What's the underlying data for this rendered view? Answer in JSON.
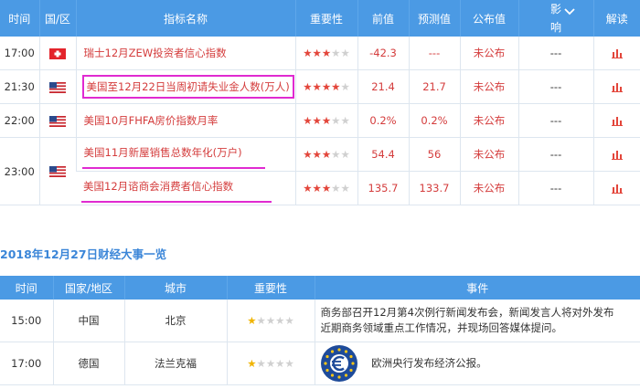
{
  "table1": {
    "headers": [
      "时间",
      "国/区",
      "指标名称",
      "重要性",
      "前值",
      "预测值",
      "公布值",
      "影　响",
      "解读"
    ],
    "rows": [
      {
        "time": "17:00",
        "flag": "switzerland",
        "name": "瑞士12月ZEW投资者信心指数",
        "stars": 3,
        "prev": "-42.3",
        "forecast": "---",
        "actual": "未公布",
        "impact": "---"
      },
      {
        "time": "21:30",
        "flag": "usa",
        "name": "美国至12月22日当周初请失业金人数(万人)",
        "stars": 4,
        "prev": "21.4",
        "forecast": "21.7",
        "actual": "未公布",
        "impact": "---"
      },
      {
        "time": "22:00",
        "flag": "usa",
        "name": "美国10月FHFA房价指数月率",
        "stars": 3,
        "prev": "0.2%",
        "forecast": "0.2%",
        "actual": "未公布",
        "impact": "---"
      },
      {
        "time": "23:00",
        "flag": "usa",
        "name": "美国11月新屋销售总数年化(万户)",
        "stars": 3,
        "prev": "54.4",
        "forecast": "56",
        "actual": "未公布",
        "impact": "---"
      },
      {
        "time": "",
        "flag": "",
        "name": "美国12月谘商会消费者信心指数",
        "stars": 3,
        "prev": "135.7",
        "forecast": "133.7",
        "actual": "未公布",
        "impact": "---"
      }
    ]
  },
  "section_title": "2018年12月27日财经大事一览",
  "table2": {
    "headers": [
      "时间",
      "国家/地区",
      "城市",
      "重要性",
      "事件"
    ],
    "rows": [
      {
        "time": "15:00",
        "country": "中国",
        "city": "北京",
        "stars": 1,
        "event_line1": "商务部召开12月第4次例行新闻发布会，新闻发言人将对外发布",
        "event_line2": "近期商务领域重点工作情况，并现场回答媒体提问。"
      },
      {
        "time": "17:00",
        "country": "德国",
        "city": "法兰克福",
        "stars": 1,
        "event_line1": "欧洲央行发布经济公报。",
        "event_line2": ""
      }
    ]
  }
}
